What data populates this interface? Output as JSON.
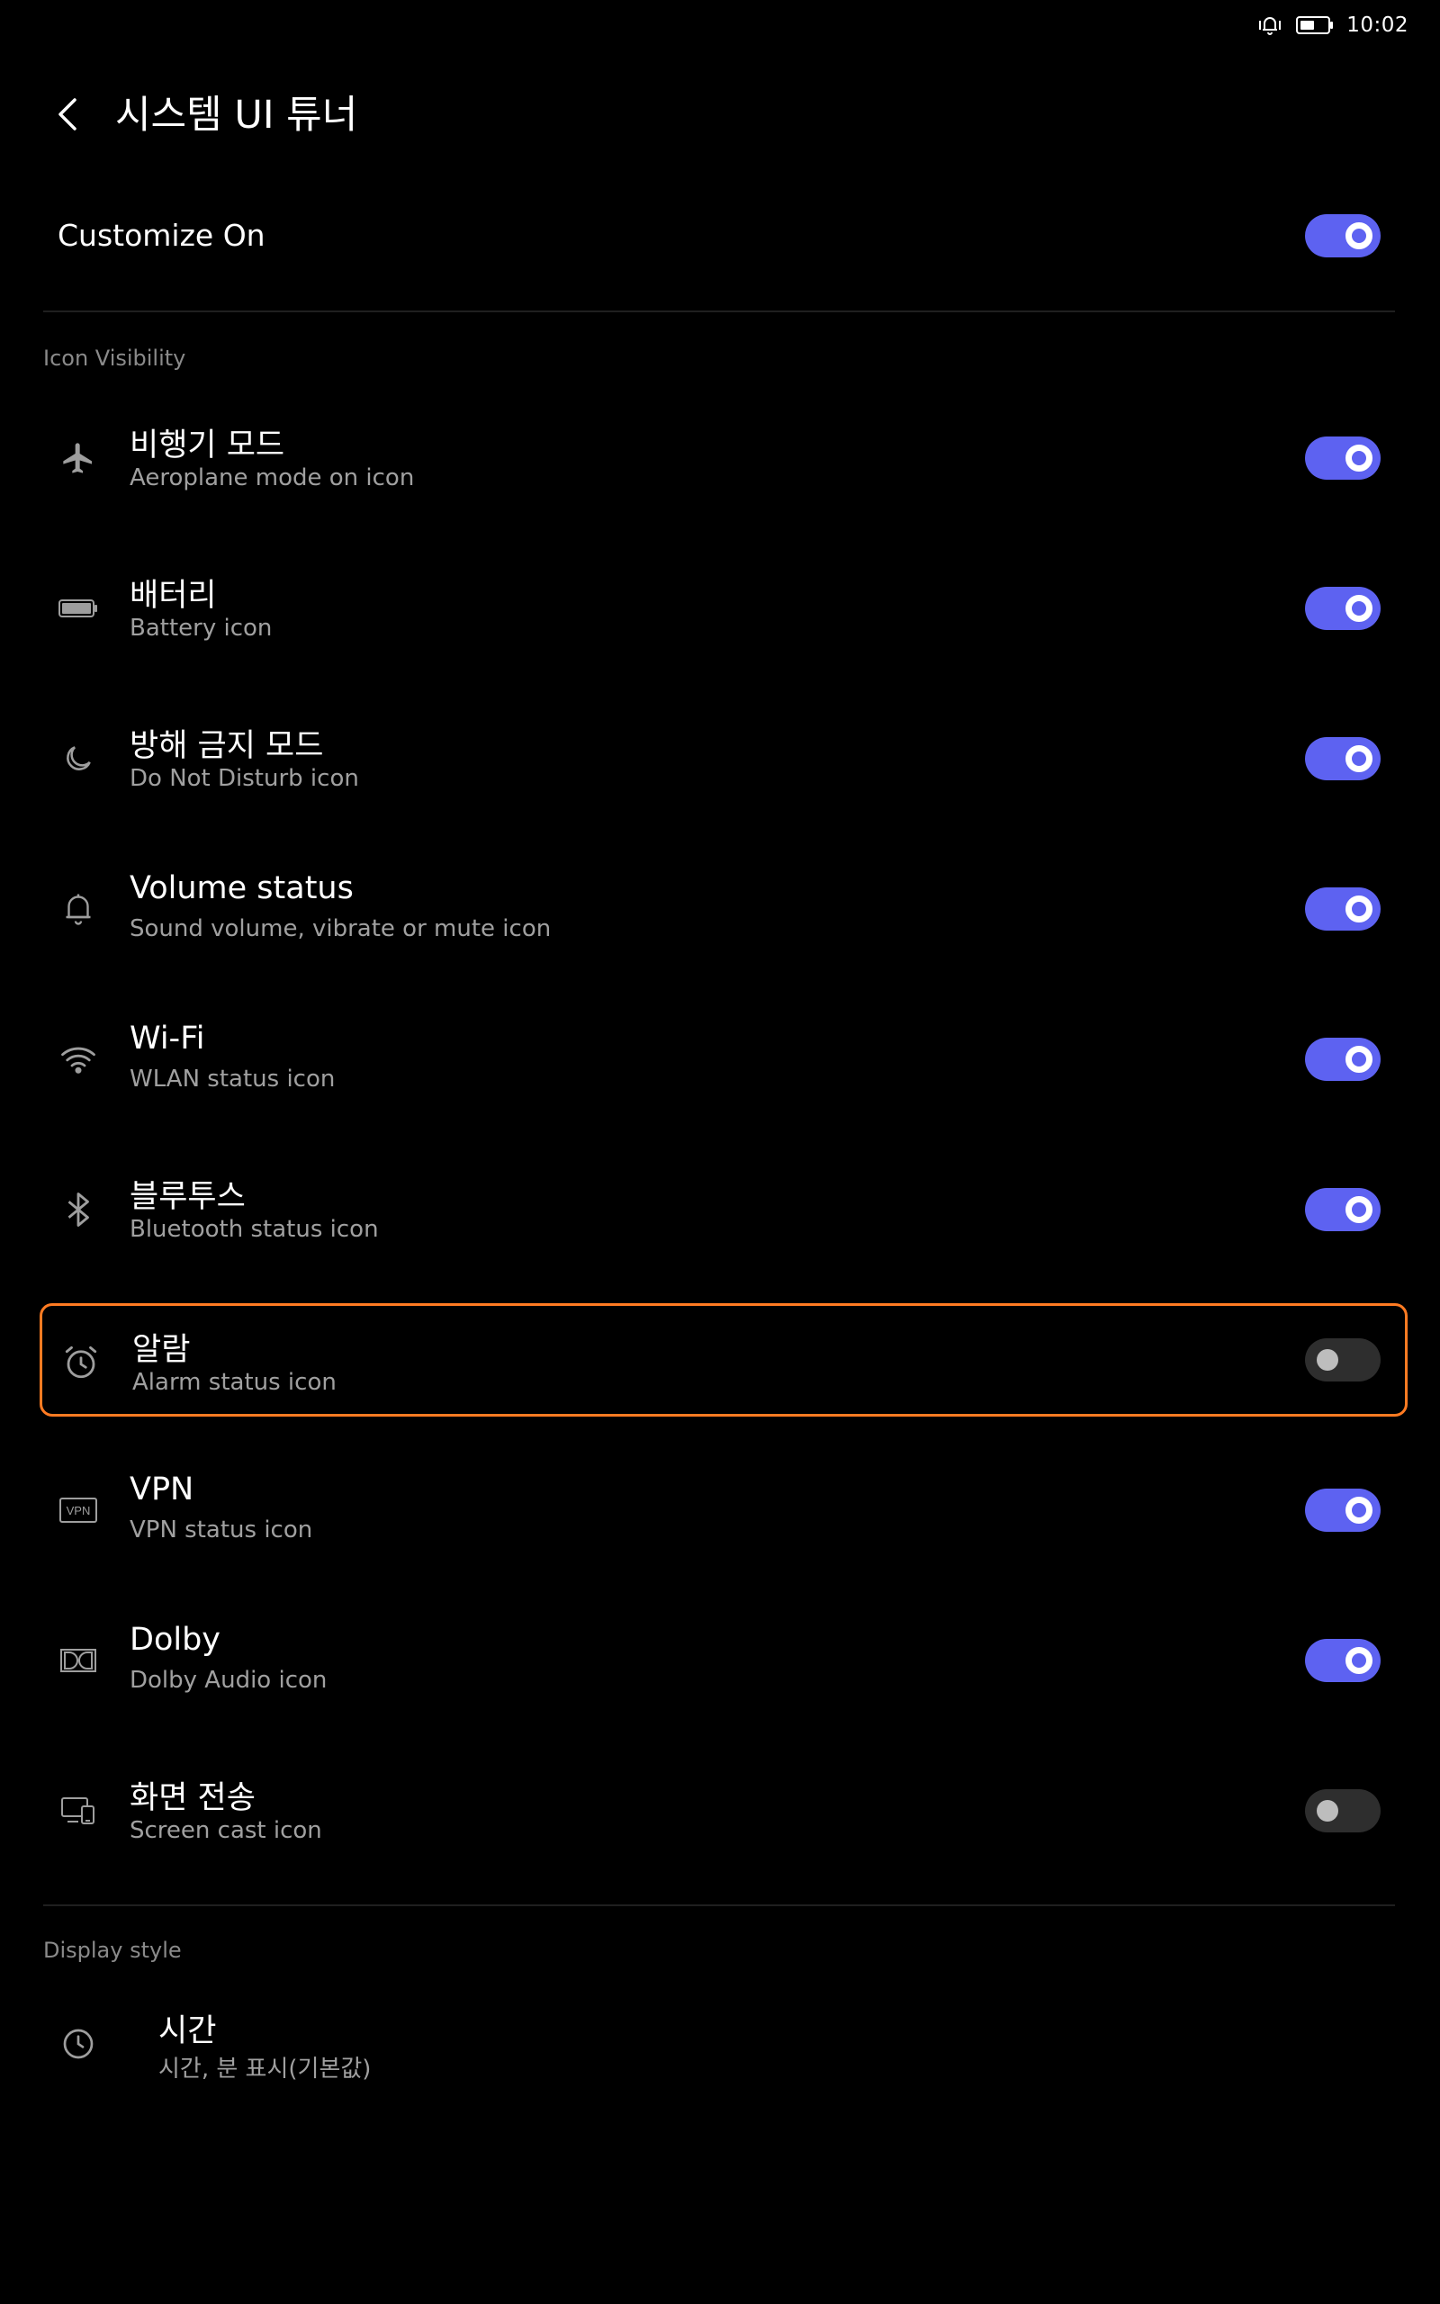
{
  "status_bar": {
    "time": "10:02",
    "icons": [
      "vibrate-bell-icon",
      "battery-icon"
    ]
  },
  "app_bar": {
    "back_icon": "back-arrow-icon",
    "title": "시스템 UI 튜너"
  },
  "master_toggle": {
    "label": "Customize On",
    "on": true
  },
  "sections": {
    "icon_visibility": {
      "header": "Icon Visibility",
      "items": [
        {
          "title": "비행기 모드",
          "subtitle": "Aeroplane mode on icon",
          "icon": "airplane-icon",
          "on": true
        },
        {
          "title": "배터리",
          "subtitle": "Battery icon",
          "icon": "battery-icon",
          "on": true
        },
        {
          "title": "방해 금지 모드",
          "subtitle": "Do Not Disturb icon",
          "icon": "moon-icon",
          "on": true
        },
        {
          "title": "Volume status",
          "subtitle": "Sound volume, vibrate or mute icon",
          "icon": "bell-icon",
          "on": true
        },
        {
          "title": "Wi-Fi",
          "subtitle": "WLAN status icon",
          "icon": "wifi-icon",
          "on": true
        },
        {
          "title": "블루투스",
          "subtitle": "Bluetooth status icon",
          "icon": "bluetooth-icon",
          "on": true
        },
        {
          "title": "알람",
          "subtitle": "Alarm status icon",
          "icon": "alarm-clock-icon",
          "on": false,
          "highlighted": true
        },
        {
          "title": "VPN",
          "subtitle": "VPN status icon",
          "icon": "vpn-icon",
          "icon_text": "VPN",
          "on": true
        },
        {
          "title": "Dolby",
          "subtitle": "Dolby Audio icon",
          "icon": "dolby-icon",
          "on": true
        },
        {
          "title": "화면 전송",
          "subtitle": "Screen cast icon",
          "icon": "screen-cast-icon",
          "on": false
        }
      ]
    },
    "display_style": {
      "header": "Display style",
      "items": [
        {
          "title": "시간",
          "subtitle": "시간, 분 표시(기본값)",
          "icon": "clock-icon"
        }
      ]
    }
  },
  "colors": {
    "background": "#000000",
    "toggle_on": "#5d62f1",
    "toggle_off": "#2e2e2e",
    "highlight": "#ff7b22",
    "secondary_text": "#a0a0a0",
    "section_header": "#8a8a8a"
  }
}
